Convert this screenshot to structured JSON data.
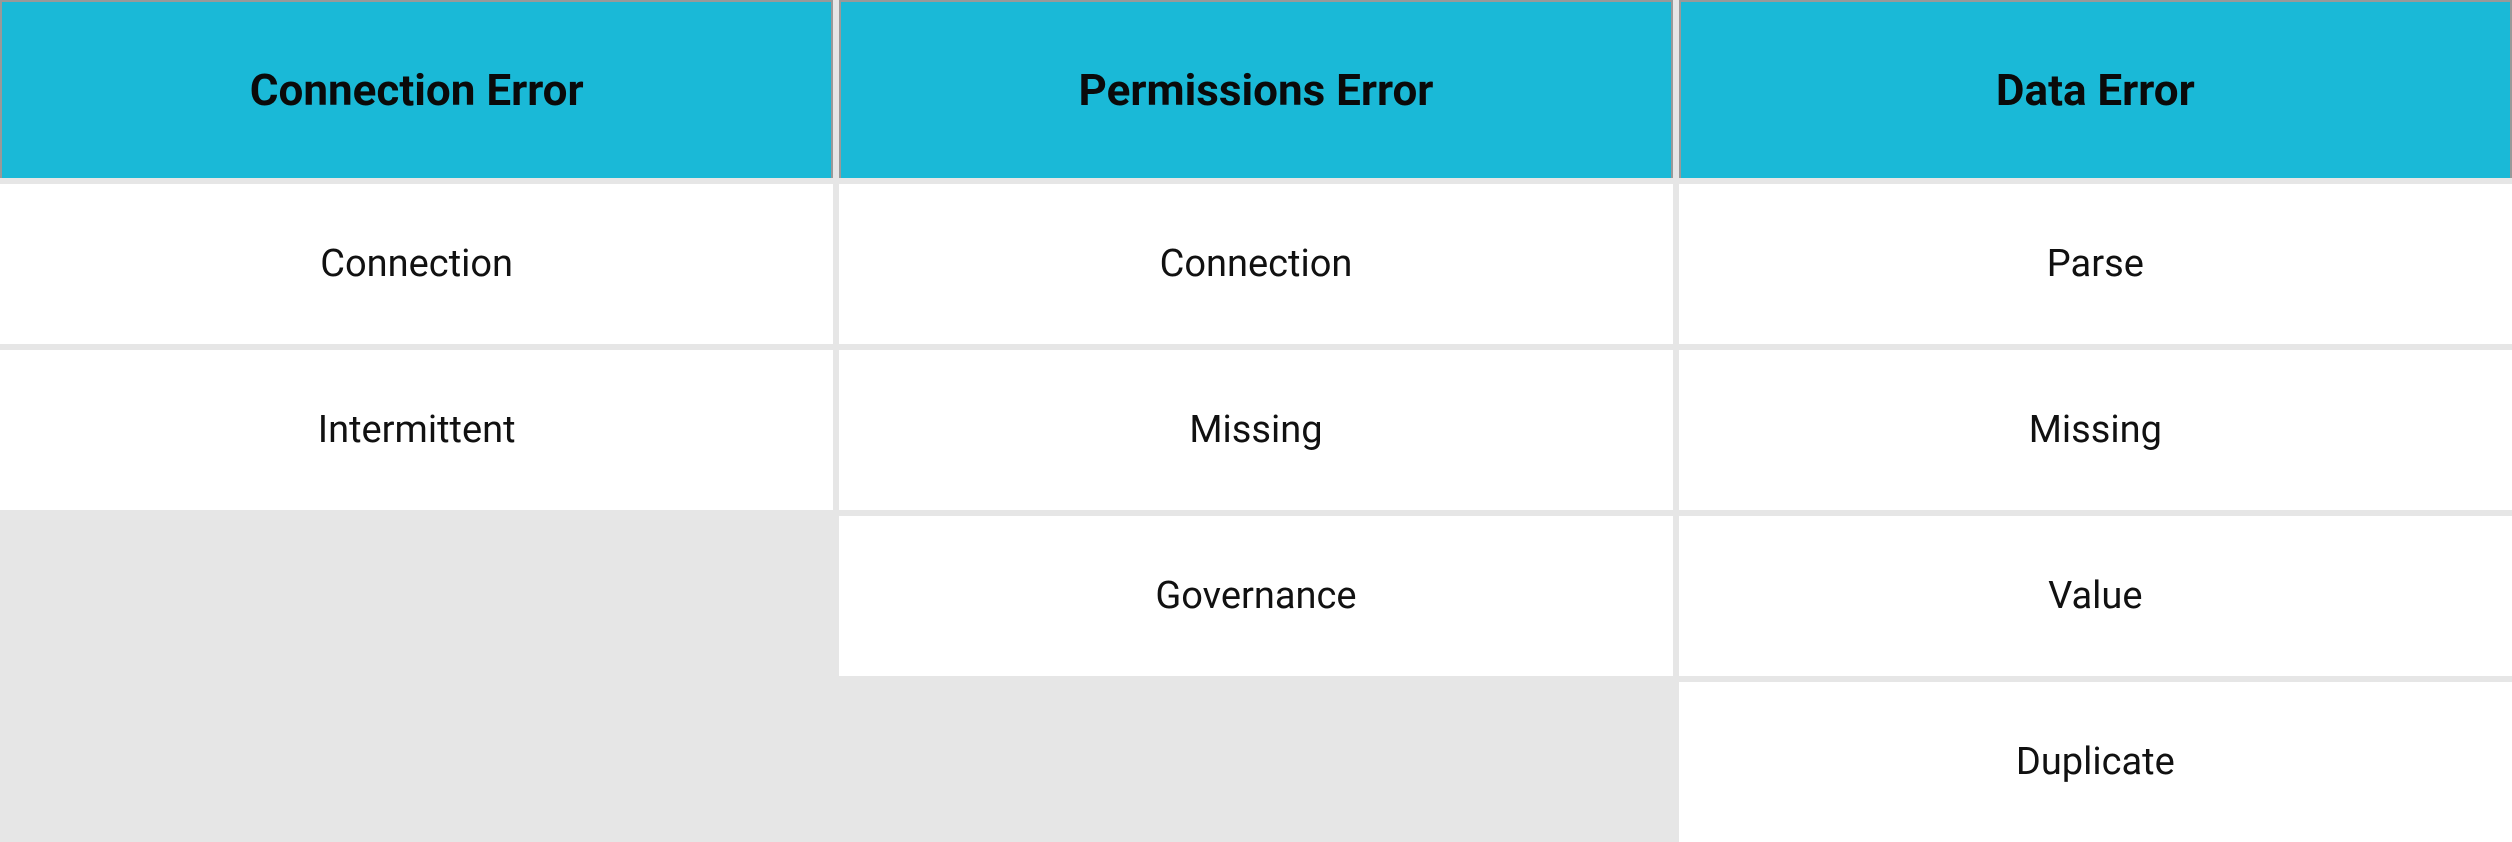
{
  "table": {
    "headers": [
      "Connection Error",
      "Permissions Error",
      "Data Error"
    ],
    "rows": [
      [
        "Connection",
        "Connection",
        "Parse"
      ],
      [
        "Intermittent",
        "Missing",
        "Missing"
      ],
      [
        "",
        "Governance",
        "Value"
      ],
      [
        "",
        "",
        "Duplicate"
      ]
    ]
  }
}
